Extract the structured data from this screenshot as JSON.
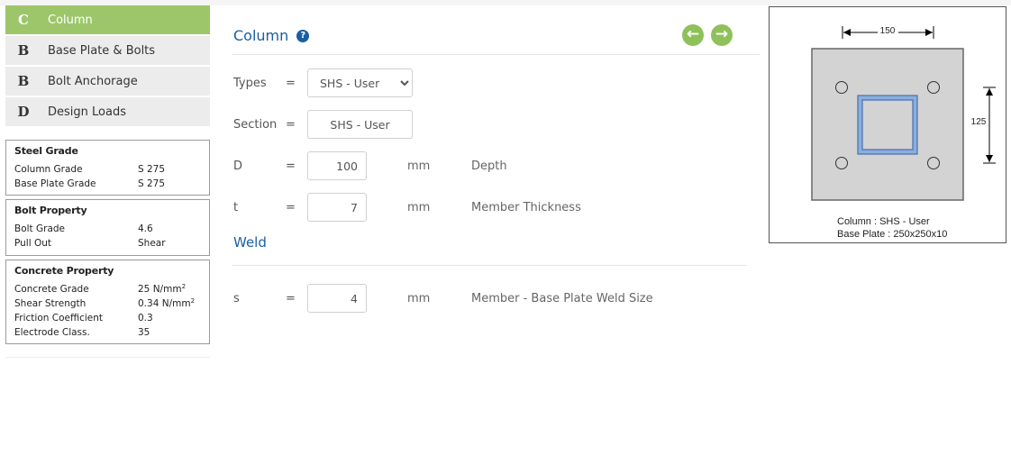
{
  "nav": [
    {
      "letter": "C",
      "label": "Column",
      "active": true
    },
    {
      "letter": "B",
      "label": "Base Plate & Bolts",
      "active": false
    },
    {
      "letter": "B",
      "label": "Bolt Anchorage",
      "active": false
    },
    {
      "letter": "D",
      "label": "Design Loads",
      "active": false
    }
  ],
  "steel_grade": {
    "title": "Steel Grade",
    "rows": [
      {
        "key": "Column Grade",
        "value": "S 275"
      },
      {
        "key": "Base Plate Grade",
        "value": "S 275"
      }
    ]
  },
  "bolt_property": {
    "title": "Bolt Property",
    "rows": [
      {
        "key": "Bolt Grade",
        "value": "4.6"
      },
      {
        "key": "Pull Out",
        "value": "Shear"
      }
    ]
  },
  "concrete_property": {
    "title": "Concrete Property",
    "rows": [
      {
        "key": "Concrete Grade",
        "value": "25 N/mm",
        "sup": "2"
      },
      {
        "key": "Shear Strength",
        "value": "0.34 N/mm",
        "sup": "2"
      },
      {
        "key": "Friction Coefficient",
        "value": "0.3"
      },
      {
        "key": "Electrode Class.",
        "value": "35"
      }
    ]
  },
  "main": {
    "title": "Column",
    "help_icon": "question-circle-icon",
    "prev_icon": "arrow-left-circle-icon",
    "next_icon": "arrow-right-circle-icon",
    "types": {
      "label": "Types",
      "eq": "=",
      "value": "SHS - User"
    },
    "section": {
      "label": "Section",
      "eq": "=",
      "value": "SHS - User"
    },
    "depth": {
      "label": "D",
      "eq": "=",
      "value": "100",
      "unit": "mm",
      "desc": "Depth"
    },
    "thickness": {
      "label": "t",
      "eq": "=",
      "value": "7",
      "unit": "mm",
      "desc": "Member Thickness"
    },
    "weld_title": "Weld",
    "weld": {
      "label": "s",
      "eq": "=",
      "value": "4",
      "unit": "mm",
      "desc": "Member - Base Plate Weld Size"
    }
  },
  "diagram": {
    "dim_horizontal": "150",
    "dim_vertical": "125",
    "caption_column": "Column : SHS - User",
    "caption_plate": "Base Plate : 250x250x10",
    "plate_color": "#d3d3d3",
    "section_color": "#8aaee0"
  }
}
